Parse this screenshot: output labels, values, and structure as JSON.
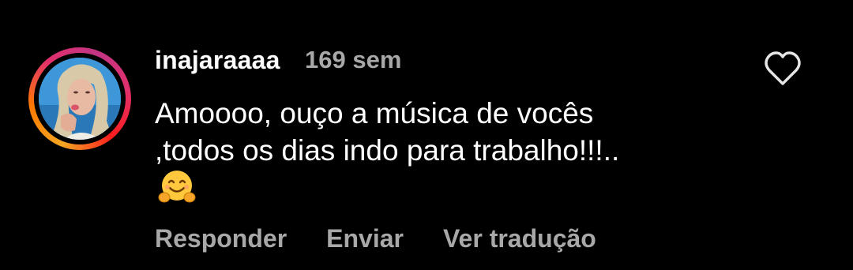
{
  "comment": {
    "username": "inajaraaaa",
    "timestamp": "169 sem",
    "text": "Amoooo, ouço a música de vocês ,todos os dias indo para trabalho!!!..",
    "emoji": "hugging-face-emoji",
    "actions": {
      "reply": "Responder",
      "send": "Enviar",
      "translate": "Ver tradução"
    },
    "like_icon": "heart-outline-icon"
  },
  "colors": {
    "background": "#000000",
    "primary_text": "#ffffff",
    "secondary_text": "#a8a8a8"
  }
}
